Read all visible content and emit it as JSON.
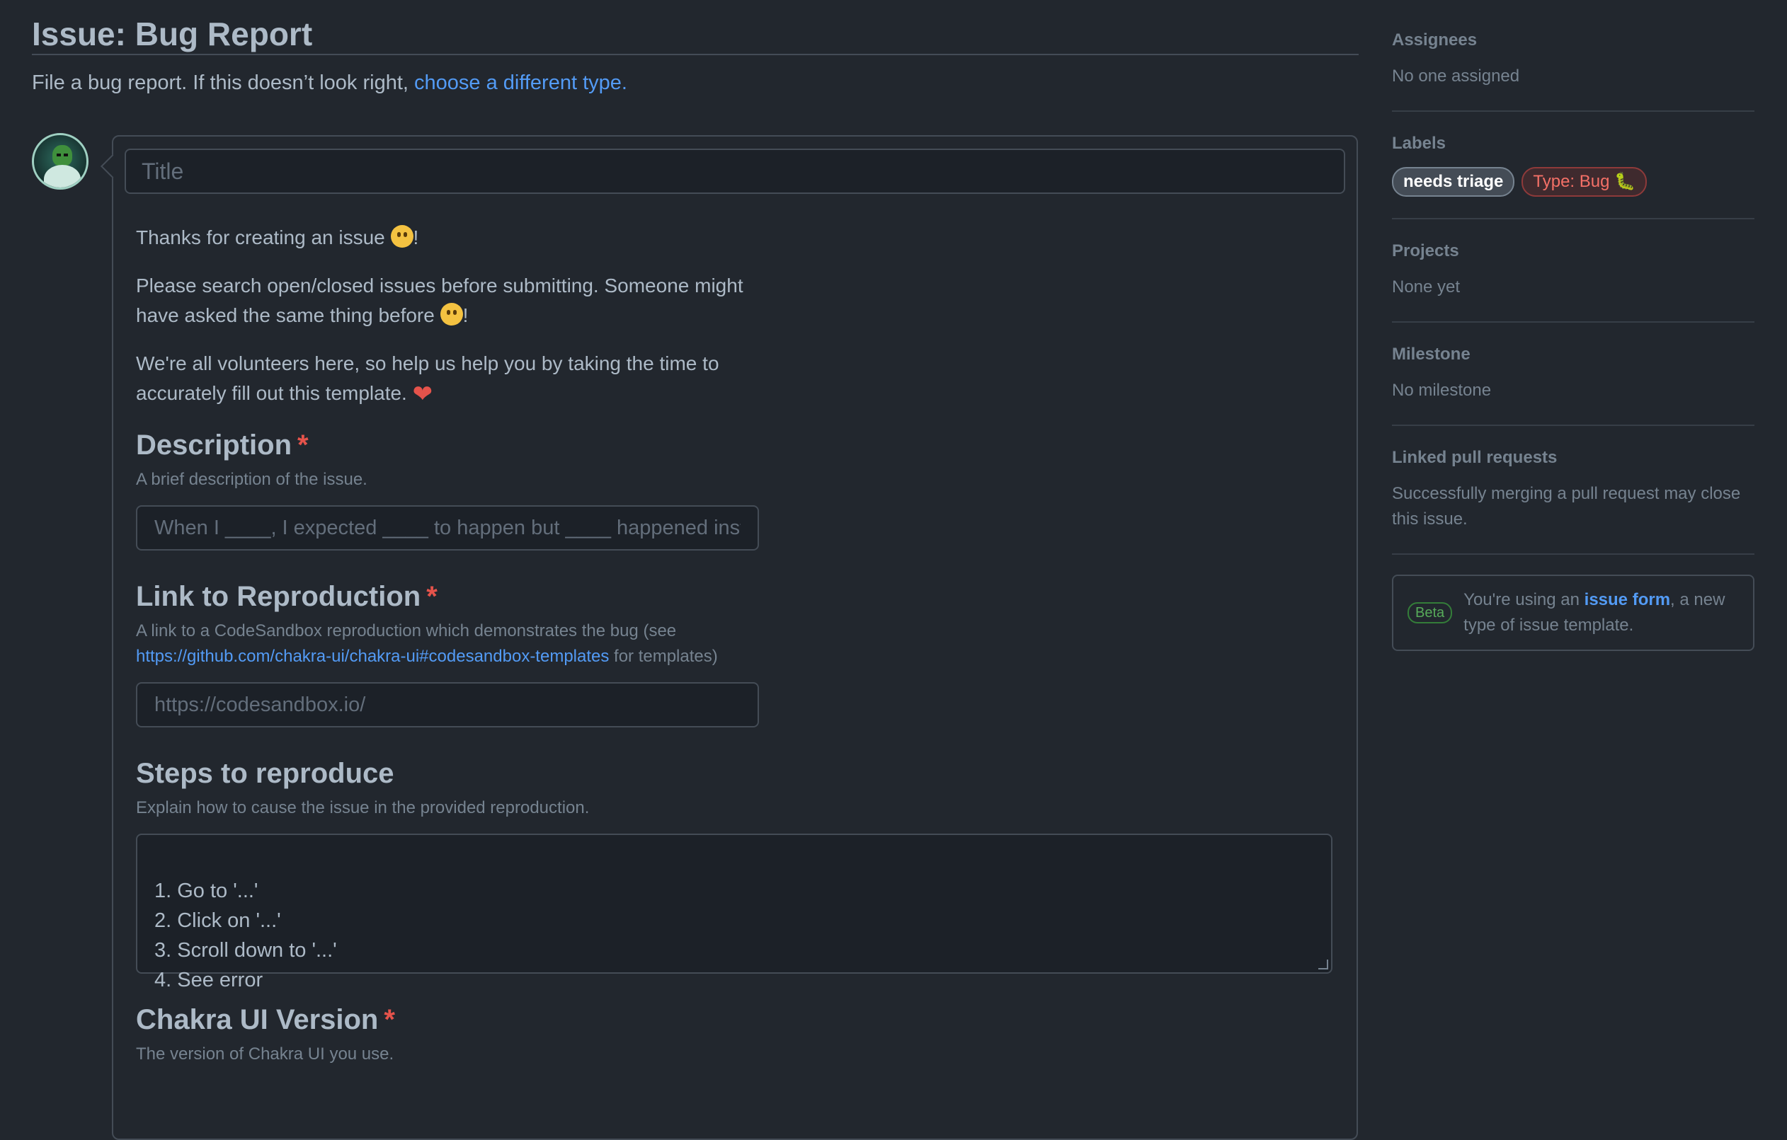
{
  "page": {
    "title": "Issue: Bug Report",
    "subtitle_prefix": "File a bug report. If this doesn’t look right, ",
    "subtitle_link": "choose a different type."
  },
  "form": {
    "title_placeholder": "Title",
    "intro": {
      "line1": "Thanks for creating an issue",
      "line1_suffix": "!",
      "line2": "Please search open/closed issues before submitting. Someone might have asked the same thing before",
      "line2_suffix": "!",
      "line3": "We're all volunteers here, so help us help you by taking the time to accurately fill out this template."
    },
    "description": {
      "label": "Description",
      "required_mark": "*",
      "desc": "A brief description of the issue.",
      "placeholder": "When I ____, I expected ____ to happen but ____ happened instead."
    },
    "reproduction": {
      "label": "Link to Reproduction",
      "required_mark": "*",
      "desc_prefix": "A link to a CodeSandbox reproduction which demonstrates the bug (see ",
      "desc_link": "https://github.com/chakra-ui/chakra-ui#codesandbox-templates",
      "desc_suffix": " for templates)",
      "placeholder": "https://codesandbox.io/"
    },
    "steps": {
      "label": "Steps to reproduce",
      "desc": "Explain how to cause the issue in the provided reproduction.",
      "value": "1. Go to '...'\n2. Click on '...'\n3. Scroll down to '...'\n4. See error"
    },
    "version": {
      "label": "Chakra UI Version",
      "required_mark": "*",
      "desc": "The version of Chakra UI you use."
    }
  },
  "sidebar": {
    "assignees": {
      "heading": "Assignees",
      "value": "No one assigned"
    },
    "labels": {
      "heading": "Labels",
      "items": [
        "needs triage",
        "Type: Bug 🐛"
      ]
    },
    "projects": {
      "heading": "Projects",
      "value": "None yet"
    },
    "milestone": {
      "heading": "Milestone",
      "value": "No milestone"
    },
    "linked_prs": {
      "heading": "Linked pull requests",
      "value": "Successfully merging a pull request may close this issue."
    },
    "beta": {
      "badge": "Beta",
      "prefix": "You're using an ",
      "link": "issue form",
      "suffix": ", a new type of issue template."
    }
  },
  "colors": {
    "background": "#22272e",
    "accent_link": "#539bf5",
    "required": "#e5534b",
    "label_bug": "#f47067"
  }
}
